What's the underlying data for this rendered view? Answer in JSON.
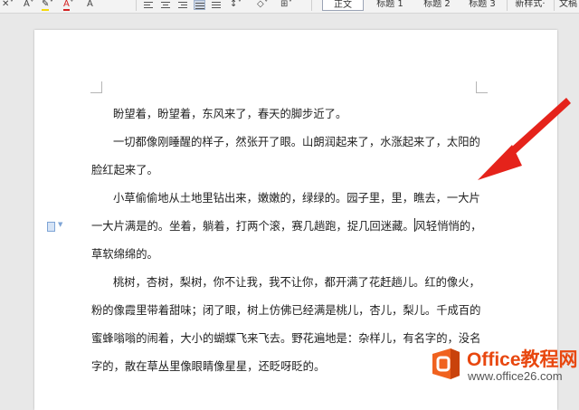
{
  "toolbar": {
    "styles": [
      "正文",
      "标题 1",
      "标题 2",
      "标题 3"
    ],
    "new_style": "新样式·",
    "right_cut": "文稿"
  },
  "document": {
    "paragraphs": [
      [
        "盼望着，盼望着，东风来了，春天的脚步近了。"
      ],
      [
        "一切都像刚睡醒的样子，然张开了眼。山朗润起来了，水涨起来了，太阳的",
        "脸红起来了。"
      ],
      [
        "小草偷偷地从土地里钻出来，嫩嫩的，绿绿的。园子里，里，瞧去，一大片",
        "一大片满是的。坐着，躺着，打两个滚，赛几趟跑，捉几回迷藏。",
        "草软绵绵的。"
      ],
      [
        "桃树，杏树，梨树，你不让我，我不让你，都开满了花赶趟儿。红的像火，",
        "粉的像霞里带着甜味；闭了眼，树上仿佛已经满是桃儿，杏儿，梨儿。千成百的",
        "蜜蜂嗡嗡的闹着，大小的蝴蝶飞来飞去。野花遍地是：杂样儿，有名字的，没名",
        "字的，散在草丛里像眼睛像星星，还眨呀眨的。"
      ]
    ],
    "line_after_cursor": "风轻悄悄的，"
  },
  "watermark": {
    "title": "Office教程网",
    "url": "www.office26.com"
  },
  "colors": {
    "arrow": "#e5231b",
    "logo_orange": "#f0621f",
    "watermark_text": "#e8470f"
  }
}
